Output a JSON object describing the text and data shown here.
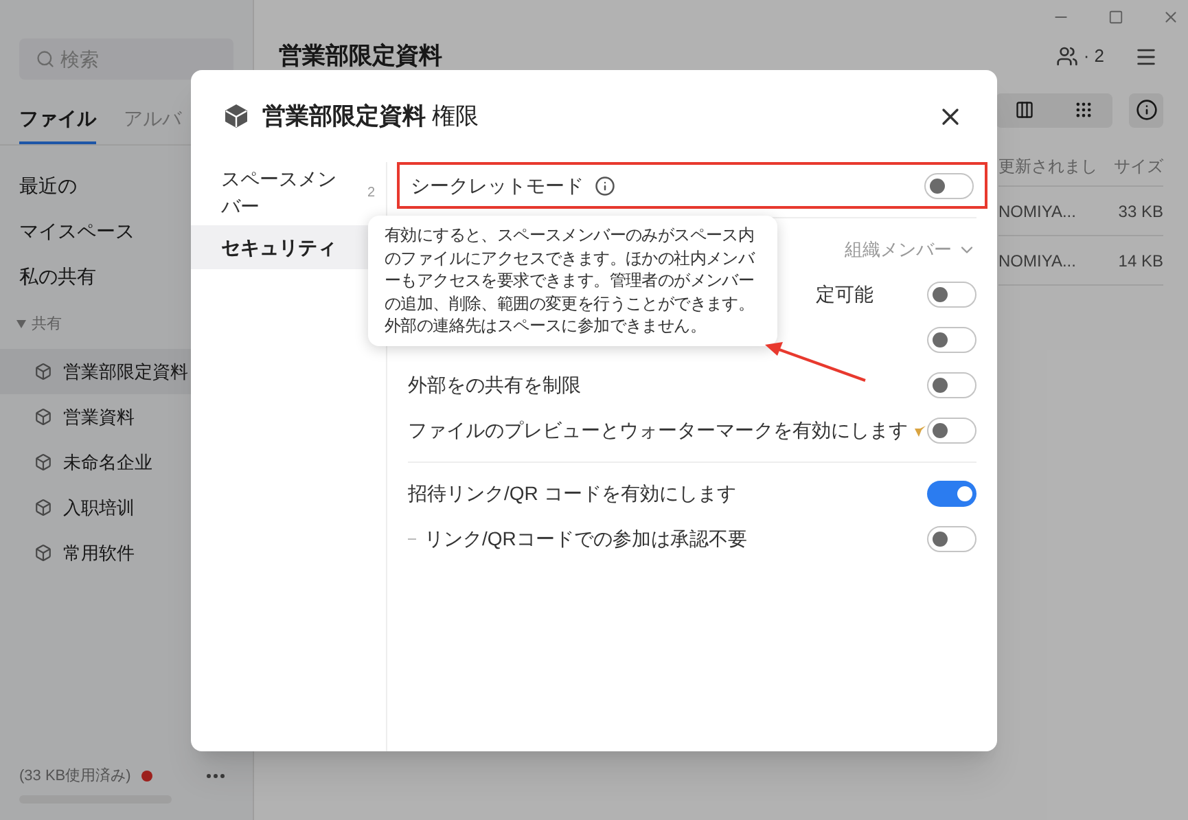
{
  "sidebar": {
    "search": {
      "placeholder": "検索"
    },
    "tabs": [
      {
        "label": "ファイル",
        "selected": true
      },
      {
        "label": "アルバ",
        "selected": false
      }
    ],
    "items": [
      {
        "label": "最近の"
      },
      {
        "label": "マイスペース"
      },
      {
        "label": "私の共有"
      }
    ],
    "group": {
      "label": "共有",
      "expanded": true,
      "children": [
        {
          "label": "営業部限定資料",
          "selected": true
        },
        {
          "label": "営業資料",
          "selected": false
        },
        {
          "label": "未命名企业",
          "selected": false
        },
        {
          "label": "入职培训",
          "selected": false
        },
        {
          "label": "常用软件",
          "selected": false
        }
      ]
    },
    "storage": {
      "text": "(33 KB使用済み)",
      "alert": true,
      "level": 0
    }
  },
  "main": {
    "title": "営業部限定資料",
    "members": "· 2",
    "table": {
      "columns": [
        "更新されまし",
        "サイズ"
      ],
      "rows": [
        [
          "NOMIYA...",
          "33 KB"
        ],
        [
          "NOMIYA...",
          "14 KB"
        ]
      ]
    }
  },
  "dialog": {
    "title": "営業部限定資料",
    "title_suffix": "権限",
    "nav": [
      {
        "label": "スペースメンバー",
        "count": "2",
        "selected": false
      },
      {
        "label": "セキュリティ",
        "selected": true
      }
    ],
    "settings": [
      {
        "kind": "toggle",
        "label": "シークレットモード",
        "info": true,
        "highlighted": true,
        "on": false
      },
      {
        "kind": "divider"
      },
      {
        "kind": "select",
        "value": "組織メンバー"
      },
      {
        "kind": "partial",
        "label": "定可能",
        "on": false
      },
      {
        "kind": "partial",
        "on": false
      },
      {
        "kind": "toggle",
        "label": "外部をの共有を制限",
        "on": false
      },
      {
        "kind": "toggle",
        "label": "ファイルのプレビューとウォーターマークを有効にします",
        "premium": true,
        "on": false
      },
      {
        "kind": "divider"
      },
      {
        "kind": "toggle",
        "label": "招待リンク/QR コードを有効にします",
        "on": true
      },
      {
        "kind": "toggle",
        "label": "リンク/QRコードでの参加は承認不要",
        "sub": true,
        "on": false
      }
    ],
    "tooltip": "有効にすると、スペースメンバーのみがスペース内のファイルにアクセスできます。ほかの社内メンバーもアクセスを要求できます。管理者のがメンバーの追加、削除、範囲の変更を行うことができます。外部の連絡先はスペースに参加できません。"
  }
}
